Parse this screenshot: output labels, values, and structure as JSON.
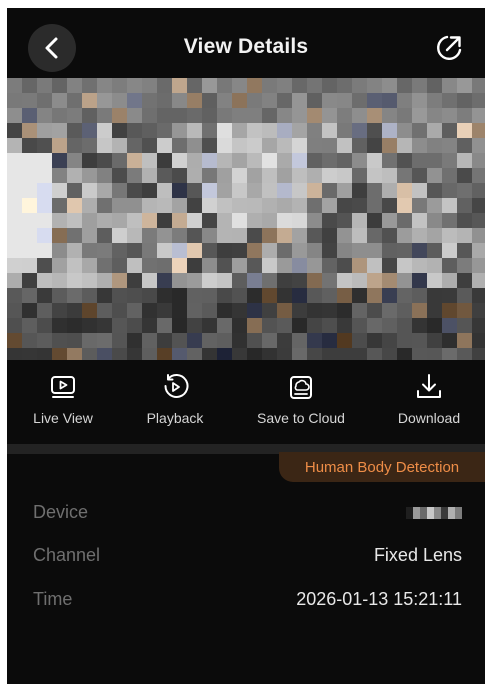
{
  "header": {
    "title": "View Details",
    "back_icon": "chevron-left-icon",
    "share_icon": "share-icon"
  },
  "media": {
    "description_icon": "pixelated-video-thumbnail"
  },
  "actions": [
    {
      "label": "Live View",
      "icon": "live-view-icon"
    },
    {
      "label": "Playback",
      "icon": "playback-icon"
    },
    {
      "label": "Save to Cloud",
      "icon": "cloud-save-icon"
    },
    {
      "label": "Download",
      "icon": "download-icon"
    }
  ],
  "event_tag": "Human Body Detection",
  "details": {
    "device_label": "Device",
    "channel_label": "Channel",
    "channel_value": "Fixed Lens",
    "time_label": "Time",
    "time_value": "2026-01-13 15:21:11"
  },
  "colors": {
    "background": "#0b0b0b",
    "accent": "#ee8d47",
    "tag_background": "#3b2615"
  }
}
